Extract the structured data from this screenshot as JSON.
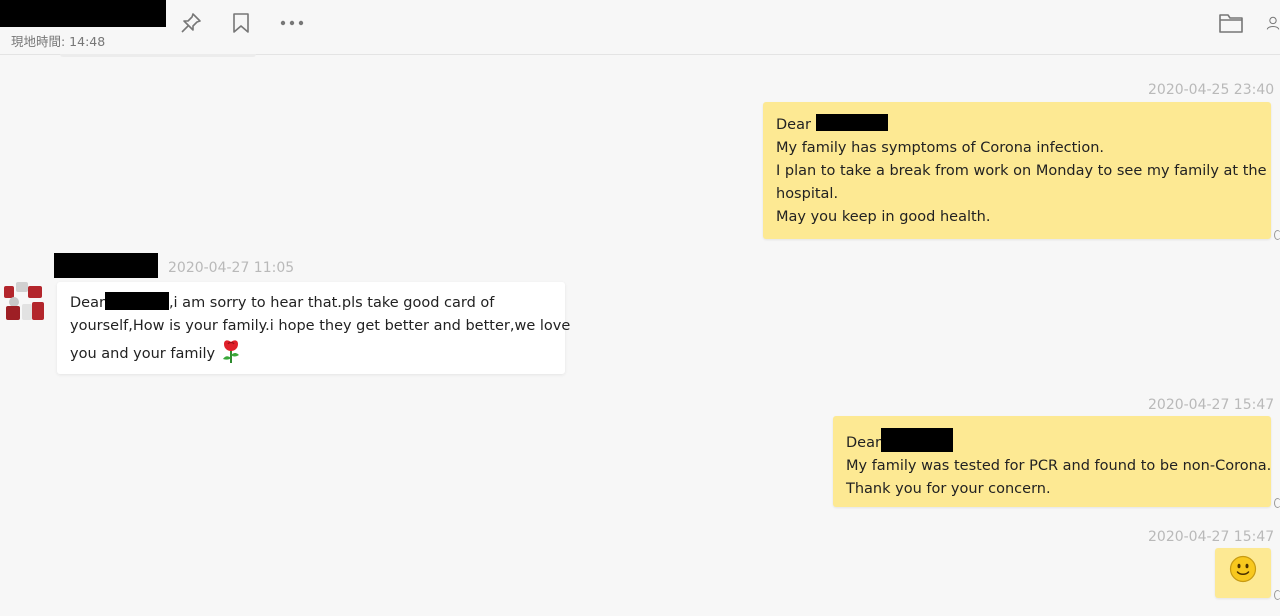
{
  "header": {
    "local_time": "現地時間: 14:48"
  },
  "toolbar": {
    "icons": [
      "pin-icon",
      "bookmark-icon",
      "more-icon",
      "folder-icon",
      "user-icon"
    ]
  },
  "messages": [
    {
      "direction": "out",
      "timestamp": "2020-04-25 23:40",
      "greeting": "Dear",
      "lines": [
        "My family has symptoms of Corona infection.",
        "I plan to take a break from work on Monday to see my family at the",
        "hospital.",
        "May you keep in good health."
      ]
    },
    {
      "direction": "in",
      "timestamp": "2020-04-27 11:05",
      "greeting": "Dear",
      "first_line_rest": ",i am sorry to hear that.pls take good card of",
      "lines": [
        "yourself,How is your family.i hope they get better and better,we love",
        "you and your family"
      ],
      "emoji": "rose-icon"
    },
    {
      "direction": "out",
      "timestamp": "2020-04-27 15:47",
      "greeting": "Dear",
      "lines": [
        "My family was tested for PCR and found to be non-Corona.",
        "Thank you for your concern."
      ]
    },
    {
      "direction": "out",
      "timestamp": "2020-04-27 15:47",
      "emoji": "smiley-icon"
    }
  ],
  "colors": {
    "outgoing_bubble": "#fde993",
    "incoming_bubble": "#ffffff",
    "timestamp": "#b9b9b9",
    "background": "#f7f7f7"
  }
}
